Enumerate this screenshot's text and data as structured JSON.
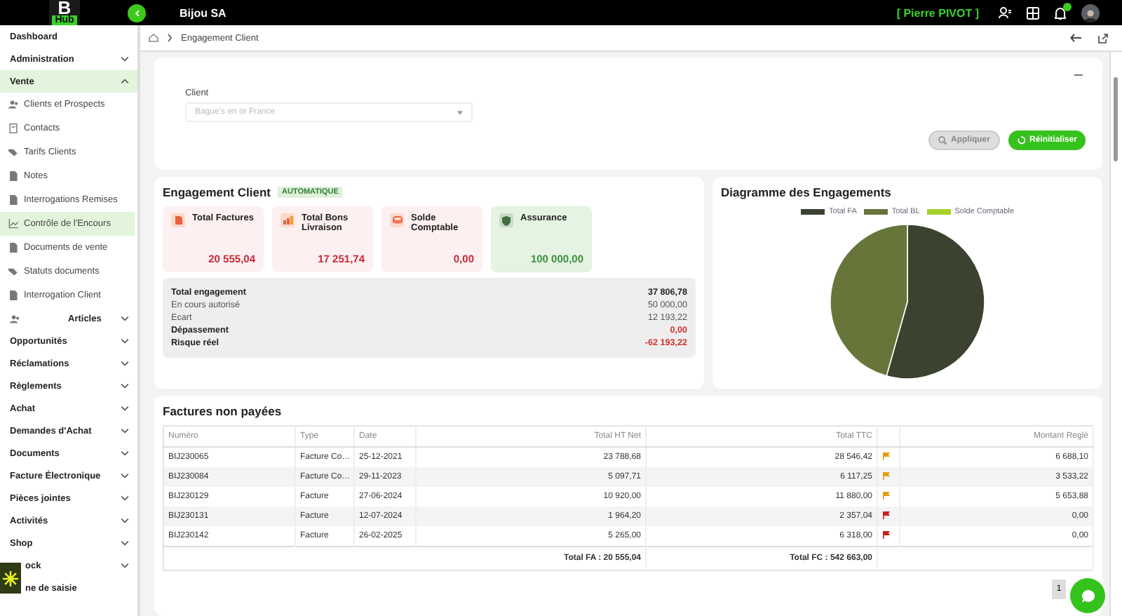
{
  "topbar": {
    "logo_letter": "B",
    "logo_word": "Hub",
    "company": "Bijou SA",
    "user": "[ Pierre PIVOT ]"
  },
  "sidebar": {
    "items": [
      {
        "label": "Dashboard",
        "selected": false
      },
      {
        "label": "Administration",
        "expanded": false,
        "selected": false
      },
      {
        "label": "Vente",
        "expanded": true,
        "selected": true,
        "children": [
          {
            "label": "Clients et Prospects",
            "selected": false
          },
          {
            "label": "Contacts",
            "selected": false
          },
          {
            "label": "Tarifs Clients",
            "selected": false
          },
          {
            "label": "Notes",
            "selected": false
          },
          {
            "label": "Interrogations Remises",
            "selected": false
          },
          {
            "label": "Contrôle de l'Encours",
            "selected": true
          },
          {
            "label": "Documents de vente",
            "selected": false
          },
          {
            "label": "Statuts documents",
            "selected": false
          },
          {
            "label": "Interrogation Client",
            "selected": false
          }
        ]
      },
      {
        "label": "Articles",
        "expanded": false,
        "selected": false
      },
      {
        "label": "Opportunités",
        "expanded": false,
        "selected": false
      },
      {
        "label": "Réclamations",
        "expanded": false,
        "selected": false
      },
      {
        "label": "Règlements",
        "expanded": false,
        "selected": false
      },
      {
        "label": "Achat",
        "expanded": false,
        "selected": false
      },
      {
        "label": "Demandes d'Achat",
        "expanded": false,
        "selected": false
      },
      {
        "label": "Documents",
        "expanded": false,
        "selected": false
      },
      {
        "label": "Facture Électronique",
        "expanded": false,
        "selected": false
      },
      {
        "label": "Pièces jointes",
        "expanded": false,
        "selected": false
      },
      {
        "label": "Activités",
        "expanded": false,
        "selected": false
      },
      {
        "label": "Shop",
        "expanded": false,
        "selected": false
      },
      {
        "label": "ock",
        "expanded": false,
        "selected": false
      },
      {
        "label": "ne de saisie",
        "selected": false
      }
    ]
  },
  "breadcrumb": {
    "current": "Engagement Client"
  },
  "filter": {
    "label": "Client",
    "placeholder": "Bague's en or France",
    "buttons": [
      {
        "label": "Appliquer",
        "kind": "search",
        "disabled": true
      },
      {
        "label": "Réinitialiser",
        "kind": "reset",
        "disabled": false
      }
    ]
  },
  "engagement": {
    "title": "Engagement Client",
    "badge": "AUTOMATIQUE",
    "cards": [
      {
        "title": "Total Factures",
        "value": "20 555,04",
        "kind": "alert"
      },
      {
        "title": "Total Bons Livraison",
        "value": "17 251,74",
        "kind": "alert"
      },
      {
        "title": "Solde Comptable",
        "value": "0,00",
        "kind": "alert"
      },
      {
        "title": "Assurance",
        "value": "100 000,00",
        "kind": "ok"
      }
    ],
    "summary": [
      {
        "label": "Total engagement",
        "value": "37 806,78",
        "bold": true,
        "negative": false
      },
      {
        "label": "En cours autorisé",
        "value": "50 000,00",
        "bold": false,
        "negative": false
      },
      {
        "label": "Ecart",
        "value": "12 193,22",
        "bold": false,
        "negative": false
      },
      {
        "label": "Dépassement",
        "value": "0,00",
        "bold": true,
        "negative": true
      },
      {
        "label": "Risque réel",
        "value": "-62 193,22",
        "bold": true,
        "negative": true
      }
    ]
  },
  "diagram": {
    "title": "Diagramme des Engagements",
    "chart_data": {
      "type": "pie",
      "categories": [
        "Total FA",
        "Total BL",
        "Solde Comptable"
      ],
      "values": [
        54.37,
        45.63,
        0
      ],
      "colors": [
        "#3b4230",
        "#66763a",
        "#a6d22c"
      ],
      "legend": true
    }
  },
  "invoices": {
    "title": "Factures non payées",
    "columns": [
      "Numéro",
      "Type",
      "Date",
      "Total HT Net",
      "Total TTC",
      "",
      "Montant Reglé"
    ],
    "rows": [
      {
        "cells": [
          "BIJ230065",
          "Facture Co…",
          "25-12-2021",
          "23 788,68",
          "28 546,42",
          "6 688,10"
        ],
        "color": "#e0a010"
      },
      {
        "cells": [
          "BIJ230084",
          "Facture Co…",
          "29-11-2023",
          "5 097,71",
          "6 117,25",
          "3 533,22"
        ],
        "color": "#e0a010"
      },
      {
        "cells": [
          "BIJ230129",
          "Facture",
          "27-06-2024",
          "10 920,00",
          "11 880,00",
          "5 653,88"
        ],
        "color": "#e0a010"
      },
      {
        "cells": [
          "BIJ230131",
          "Facture",
          "12-07-2024",
          "1 964,20",
          "2 357,04",
          "0,00"
        ],
        "color": "#cc1f1f"
      },
      {
        "cells": [
          "BIJ230142",
          "Facture",
          "26-02-2025",
          "5 265,00",
          "6 318,00",
          "0,00"
        ],
        "color": "#cc1f1f"
      }
    ],
    "total_ht": "Total FA : 20 555,04",
    "total_ttc": "Total FC : 542 663,00",
    "page": "1"
  }
}
